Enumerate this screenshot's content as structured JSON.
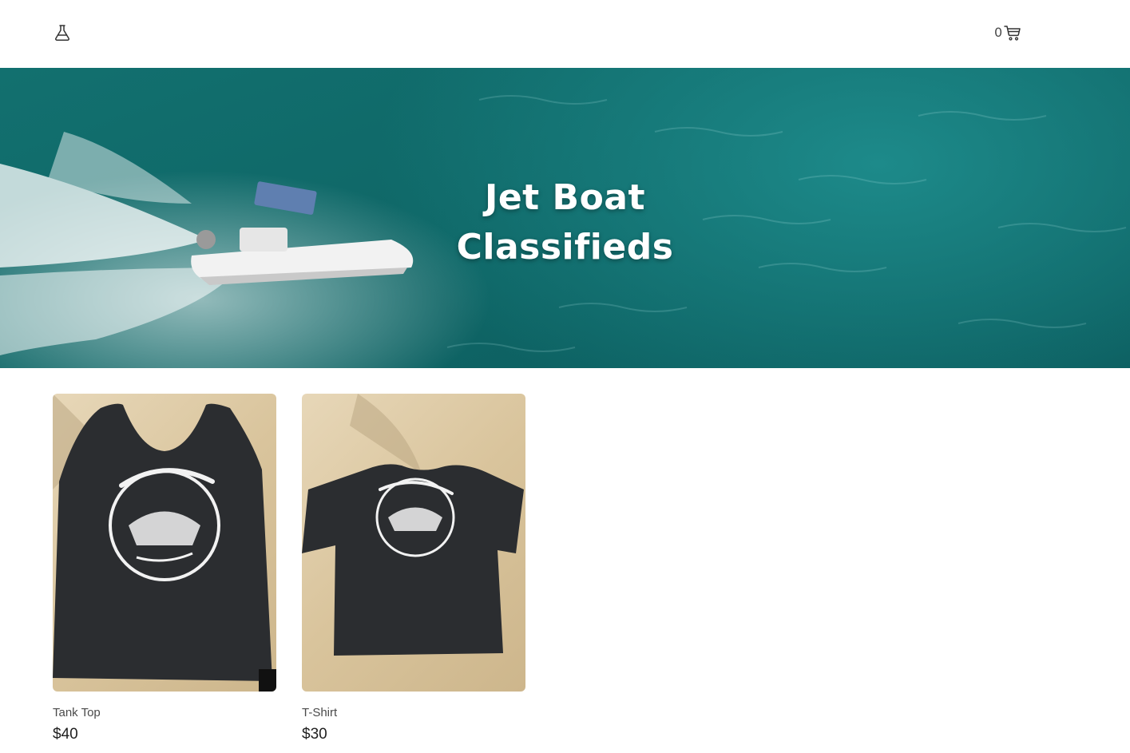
{
  "header": {
    "logo_icon": "flask-icon",
    "cart_count": "0",
    "cart_icon": "shopping-cart-icon"
  },
  "hero": {
    "title_line1": "Jet Boat",
    "title_line2": "Classifieds"
  },
  "products": [
    {
      "name": "Tank Top",
      "price": "$40"
    },
    {
      "name": "T-Shirt",
      "price": "$30"
    }
  ],
  "colors": {
    "background": "#ffffff",
    "water": "#0f6767",
    "text": "#1f1f1f",
    "muted_text": "#4a4a4a"
  }
}
